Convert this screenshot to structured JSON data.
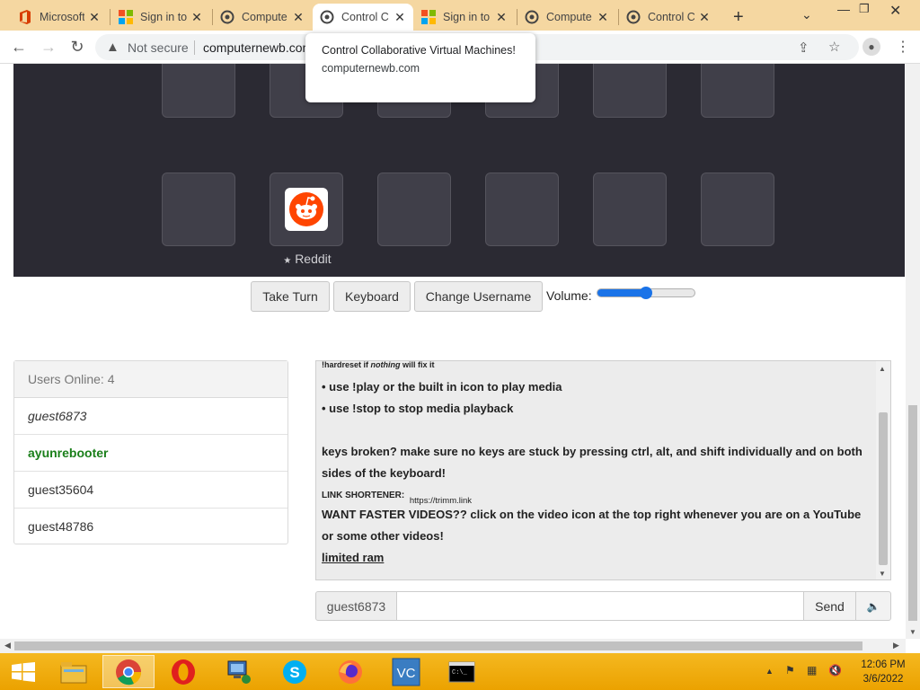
{
  "browser": {
    "tabs": [
      {
        "label": "Microsoft",
        "icon": "office-icon",
        "active": false
      },
      {
        "label": "Sign in to",
        "icon": "microsoft-icon",
        "active": false
      },
      {
        "label": "Compute",
        "icon": "cvm-icon",
        "active": false
      },
      {
        "label": "Control C",
        "icon": "cvm-icon",
        "active": true
      },
      {
        "label": "Sign in to",
        "icon": "microsoft-icon",
        "active": false
      },
      {
        "label": "Compute",
        "icon": "cvm-icon",
        "active": false
      },
      {
        "label": "Control C",
        "icon": "cvm-icon",
        "active": false
      }
    ],
    "new_tab": "+",
    "security_label": "Not secure",
    "url": "computernewb.com",
    "tooltip": {
      "title": "Control Collaborative Virtual Machines!",
      "url": "computernewb.com"
    }
  },
  "vm": {
    "desktop_icon_label": "Reddit"
  },
  "controls": {
    "take_turn": "Take Turn",
    "keyboard": "Keyboard",
    "change_username": "Change Username",
    "volume_label": "Volume:",
    "volume_level": 0.5
  },
  "users": {
    "header": "Users Online: 4",
    "list": [
      {
        "name": "guest6873",
        "style": "self"
      },
      {
        "name": "ayunrebooter",
        "style": "admin"
      },
      {
        "name": "guest35604",
        "style": "normal"
      },
      {
        "name": "guest48786",
        "style": "normal"
      }
    ]
  },
  "chat": {
    "partial_top": "!hardreset if nothing will fix it",
    "line1": "• use !play or the built in icon to play media",
    "line2": "• use !stop to stop media playback",
    "line3": "keys broken? make sure no keys are stuck by pressing ctrl, alt, and shift individually and on both sides of the keyboard!",
    "link_label": "LINK SHORTENER:",
    "link_url": "https://trimm.link",
    "line4": "WANT FASTER VIDEOS?? click on the video icon at the top right whenever you are on a YouTube or some other videos!",
    "line5": "limited ram",
    "username": "guest6873",
    "input_value": "",
    "send": "Send"
  },
  "taskbar": {
    "time": "12:06 PM",
    "date": "3/6/2022"
  },
  "colors": {
    "tab_strip": "#f5d7a1",
    "vm_background": "#2b2a33",
    "admin_name": "#1a7f1a",
    "slider_accent": "#1a73e8",
    "taskbar": "#eba200"
  }
}
